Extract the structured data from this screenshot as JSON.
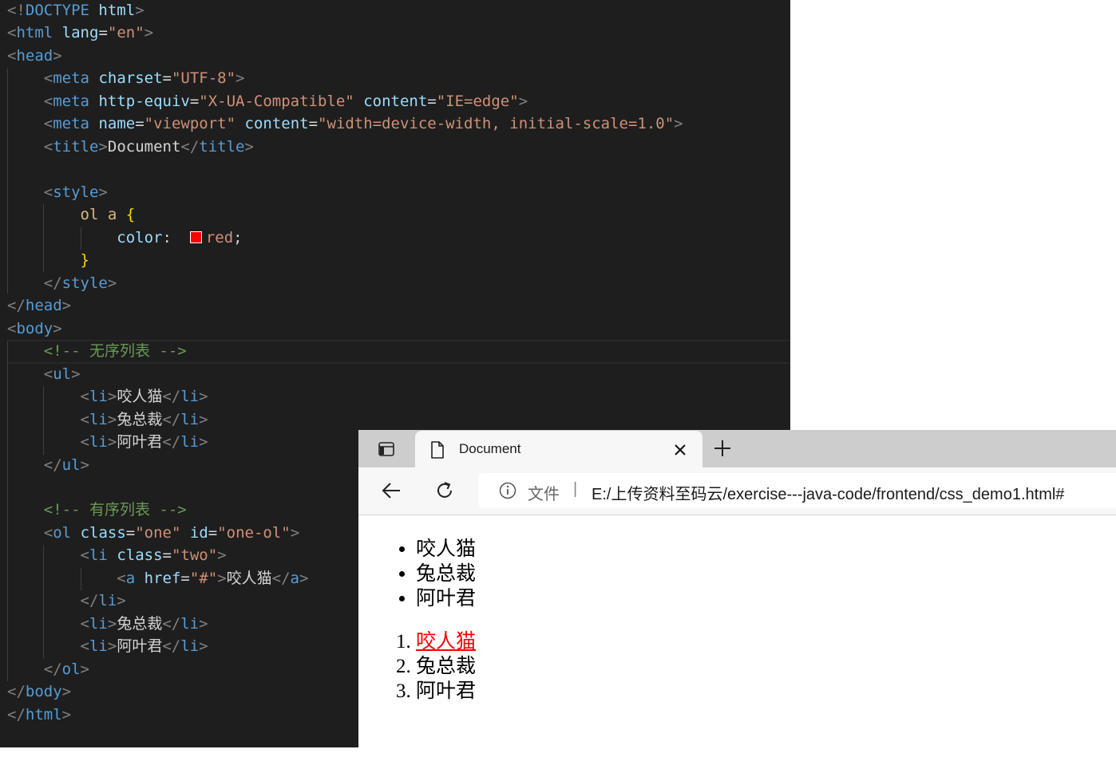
{
  "editor": {
    "comment_unordered": "<!-- 无序列表 -->",
    "comment_ordered": "<!-- 有序列表 -->",
    "list_texts": [
      "咬人猫",
      "兔总裁",
      "阿叶君"
    ],
    "doctitle": "Document"
  },
  "browser": {
    "tab": {
      "title": "Document"
    },
    "address": {
      "scheme_label": "文件",
      "separator": "|",
      "url": "E:/上传资料至码云/exercise---java-code/frontend/css_demo1.html#"
    },
    "page": {
      "ul_items": [
        "咬人猫",
        "兔总裁",
        "阿叶君"
      ],
      "ol_items": [
        "咬人猫",
        "兔总裁",
        "阿叶君"
      ],
      "ol_first_link_color": "#ff0000"
    }
  },
  "icons": [
    "sidebar-toggle-icon",
    "document-icon",
    "close-icon",
    "plus-icon",
    "back-arrow-icon",
    "reload-icon",
    "info-icon"
  ],
  "colors": {
    "editor_bg": "#1e1e1e",
    "tag": "#569cd6",
    "attr": "#9cdcfe",
    "string": "#ce9178",
    "comment": "#6a9955",
    "selector": "#d7ba7d",
    "brace": "#ffd700",
    "link": "#ff0000"
  }
}
